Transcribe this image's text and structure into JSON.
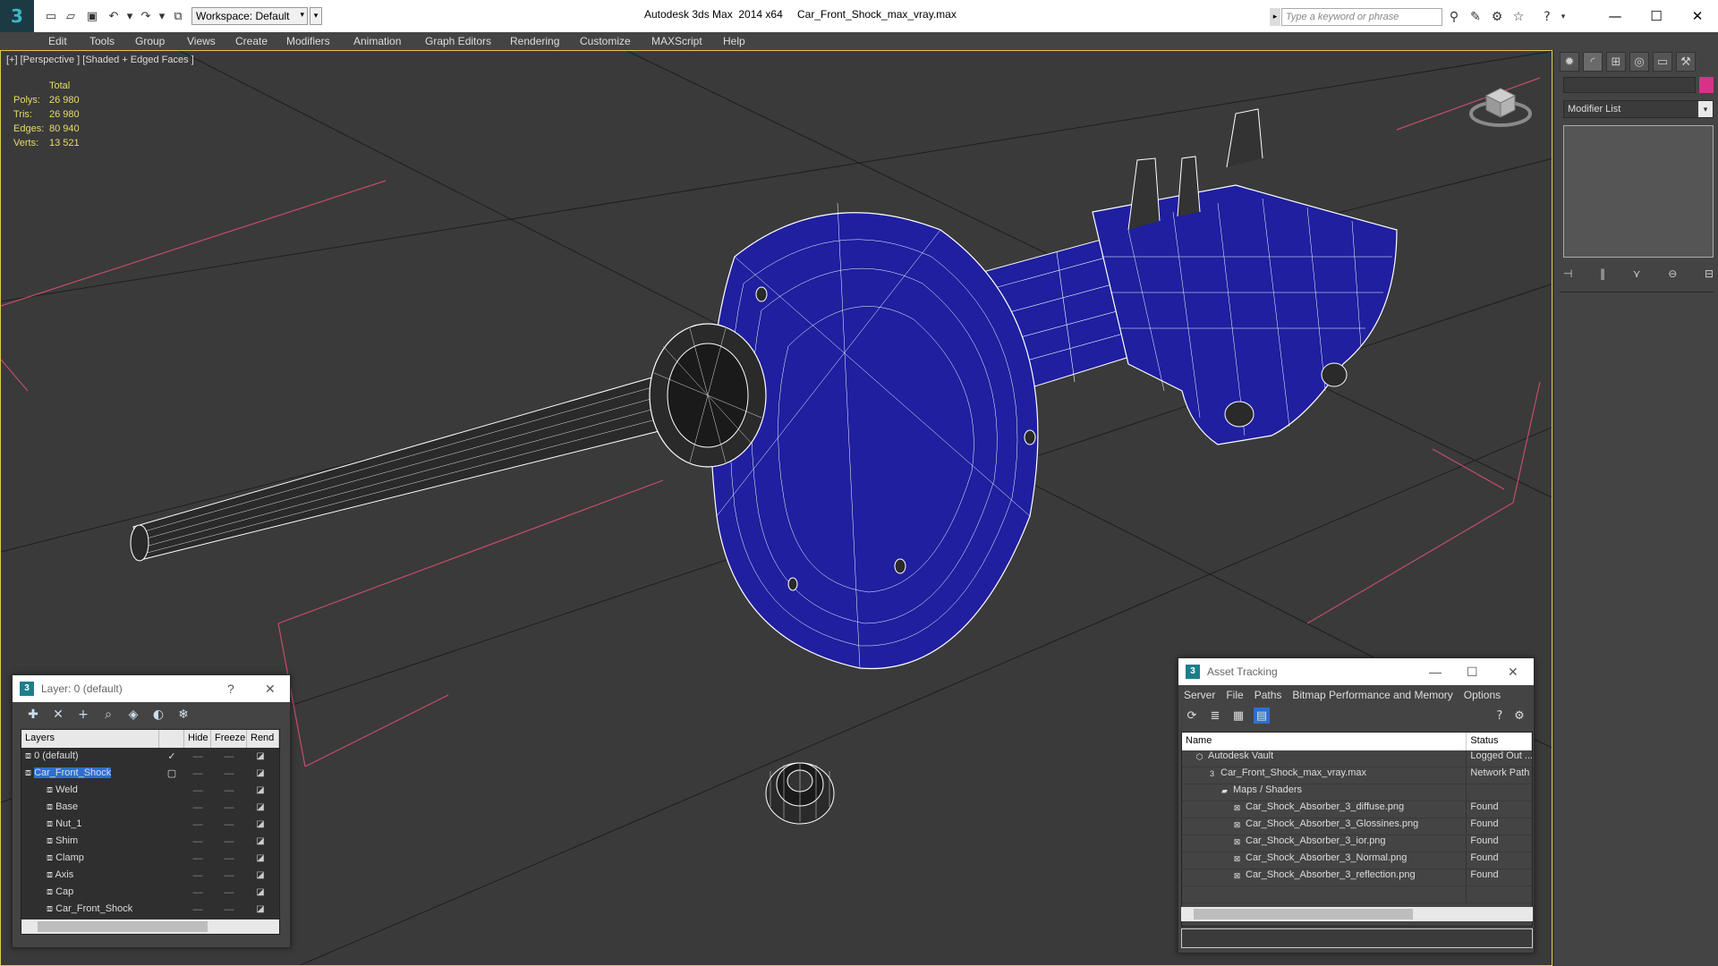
{
  "titlebar": {
    "app_title": "Autodesk 3ds Max  2014 x64",
    "file_title": "Car_Front_Shock_max_vray.max",
    "workspace": "Workspace: Default",
    "search_placeholder": "Type a keyword or phrase"
  },
  "menu": [
    "Edit",
    "Tools",
    "Group",
    "Views",
    "Create",
    "Modifiers",
    "Animation",
    "Graph Editors",
    "Rendering",
    "Customize",
    "MAXScript",
    "Help"
  ],
  "viewport": {
    "label": "[+] [Perspective ] [Shaded + Edged Faces ]",
    "stats": {
      "header": "Total",
      "rows": [
        {
          "label": "Polys:",
          "value": "26 980"
        },
        {
          "label": "Tris:",
          "value": "26 980"
        },
        {
          "label": "Edges:",
          "value": "80 940"
        },
        {
          "label": "Verts:",
          "value": "13 521"
        }
      ]
    },
    "model_color": "#1f1fa0",
    "wire_color": "#ffffff"
  },
  "command_panel": {
    "modifier_list": "Modifier List",
    "object_color": "#d63288"
  },
  "layer_dialog": {
    "title": "Layer: 0 (default)",
    "columns": [
      "Layers",
      "Hide",
      "Freeze",
      "Rend"
    ],
    "rows": [
      {
        "name": "0 (default)",
        "indent": 0,
        "check": "✓"
      },
      {
        "name": "Car_Front_Shock",
        "indent": 0,
        "check": "▢",
        "selected": true
      },
      {
        "name": "Weld",
        "indent": 1
      },
      {
        "name": "Base",
        "indent": 1
      },
      {
        "name": "Nut_1",
        "indent": 1
      },
      {
        "name": "Shim",
        "indent": 1
      },
      {
        "name": "Clamp",
        "indent": 1
      },
      {
        "name": "Axis",
        "indent": 1
      },
      {
        "name": "Cap",
        "indent": 1
      },
      {
        "name": "Car_Front_Shock",
        "indent": 1
      }
    ]
  },
  "asset_dialog": {
    "title": "Asset Tracking",
    "menu": [
      "Server",
      "File",
      "Paths",
      "Bitmap Performance and Memory",
      "Options"
    ],
    "columns": [
      "Name",
      "Status"
    ],
    "rows": [
      {
        "name": "Autodesk Vault",
        "status": "Logged Out ...",
        "indent": 1
      },
      {
        "name": "Car_Front_Shock_max_vray.max",
        "status": "Network Path",
        "indent": 2
      },
      {
        "name": "Maps / Shaders",
        "status": "",
        "indent": 3
      },
      {
        "name": "Car_Shock_Absorber_3_diffuse.png",
        "status": "Found",
        "indent": 4
      },
      {
        "name": "Car_Shock_Absorber_3_Glossines.png",
        "status": "Found",
        "indent": 4
      },
      {
        "name": "Car_Shock_Absorber_3_ior.png",
        "status": "Found",
        "indent": 4
      },
      {
        "name": "Car_Shock_Absorber_3_Normal.png",
        "status": "Found",
        "indent": 4
      },
      {
        "name": "Car_Shock_Absorber_3_reflection.png",
        "status": "Found",
        "indent": 4
      }
    ]
  }
}
